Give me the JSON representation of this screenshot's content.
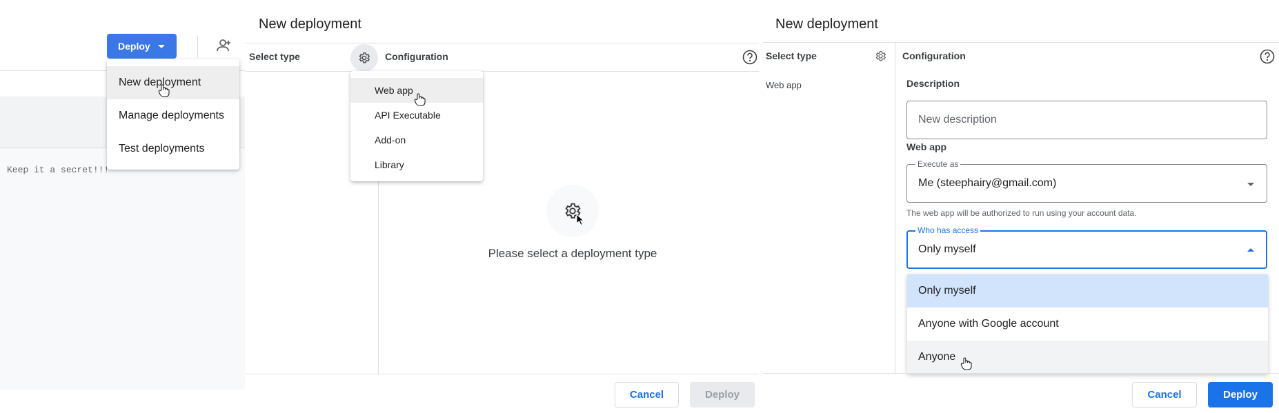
{
  "editor": {
    "deploy_button": "Deploy",
    "code_line": "Keep it a secret!!!",
    "deploy_menu": [
      {
        "label": "New deployment"
      },
      {
        "label": "Manage deployments"
      },
      {
        "label": "Test deployments"
      }
    ]
  },
  "dialog_select": {
    "title": "New deployment",
    "select_type_label": "Select type",
    "configuration_label": "Configuration",
    "type_menu": [
      {
        "label": "Web app"
      },
      {
        "label": "API Executable"
      },
      {
        "label": "Add-on"
      },
      {
        "label": "Library"
      }
    ],
    "empty_message": "Please select a deployment type",
    "cancel": "Cancel",
    "deploy": "Deploy"
  },
  "dialog_config": {
    "title": "New deployment",
    "select_type_label": "Select type",
    "selected_type": "Web app",
    "configuration_label": "Configuration",
    "description_label": "Description",
    "description_placeholder": "New description",
    "web_app_label": "Web app",
    "execute_as_legend": "Execute as",
    "execute_as_value": "Me (steephairy@gmail.com)",
    "execute_as_hint": "The web app will be authorized to run using your account data.",
    "who_has_access_legend": "Who has access",
    "who_has_access_value": "Only myself",
    "access_options": [
      {
        "label": "Only myself"
      },
      {
        "label": "Anyone with Google account"
      },
      {
        "label": "Anyone"
      }
    ],
    "cancel": "Cancel",
    "deploy": "Deploy"
  },
  "colors": {
    "primary": "#1a73e8",
    "deploy_button": "#3b78e7",
    "selected_option": "#d2e3fc"
  },
  "icons": [
    "add-person-icon",
    "gear-icon",
    "help-icon",
    "hand-cursor-icon",
    "arrow-cursor-icon"
  ]
}
